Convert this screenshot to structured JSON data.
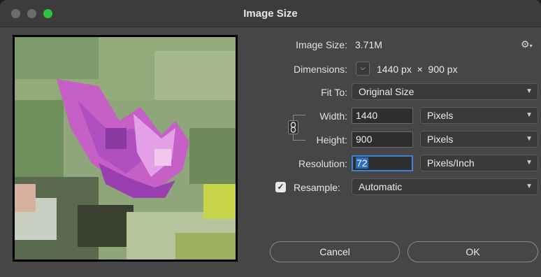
{
  "window": {
    "title": "Image Size"
  },
  "info": {
    "image_size_label": "Image Size:",
    "image_size_value": "3.71M",
    "dimensions_label": "Dimensions:",
    "dimensions_value": "1440 px  ×  900 px"
  },
  "fit_to": {
    "label": "Fit To:",
    "value": "Original Size"
  },
  "width": {
    "label": "Width:",
    "value": "1440",
    "unit": "Pixels"
  },
  "height": {
    "label": "Height:",
    "value": "900",
    "unit": "Pixels"
  },
  "resolution": {
    "label": "Resolution:",
    "value": "72",
    "unit": "Pixels/Inch"
  },
  "resample": {
    "label": "Resample:",
    "value": "Automatic",
    "checked": true
  },
  "buttons": {
    "cancel": "Cancel",
    "ok": "OK"
  },
  "colors": {
    "accent": "#3a84d6",
    "traffic_green": "#2dc440",
    "dialog_bg": "#464646"
  },
  "icons": [
    "settings-gear-icon",
    "chevron-down-icon",
    "chain-link-icon",
    "checkmark-icon"
  ]
}
